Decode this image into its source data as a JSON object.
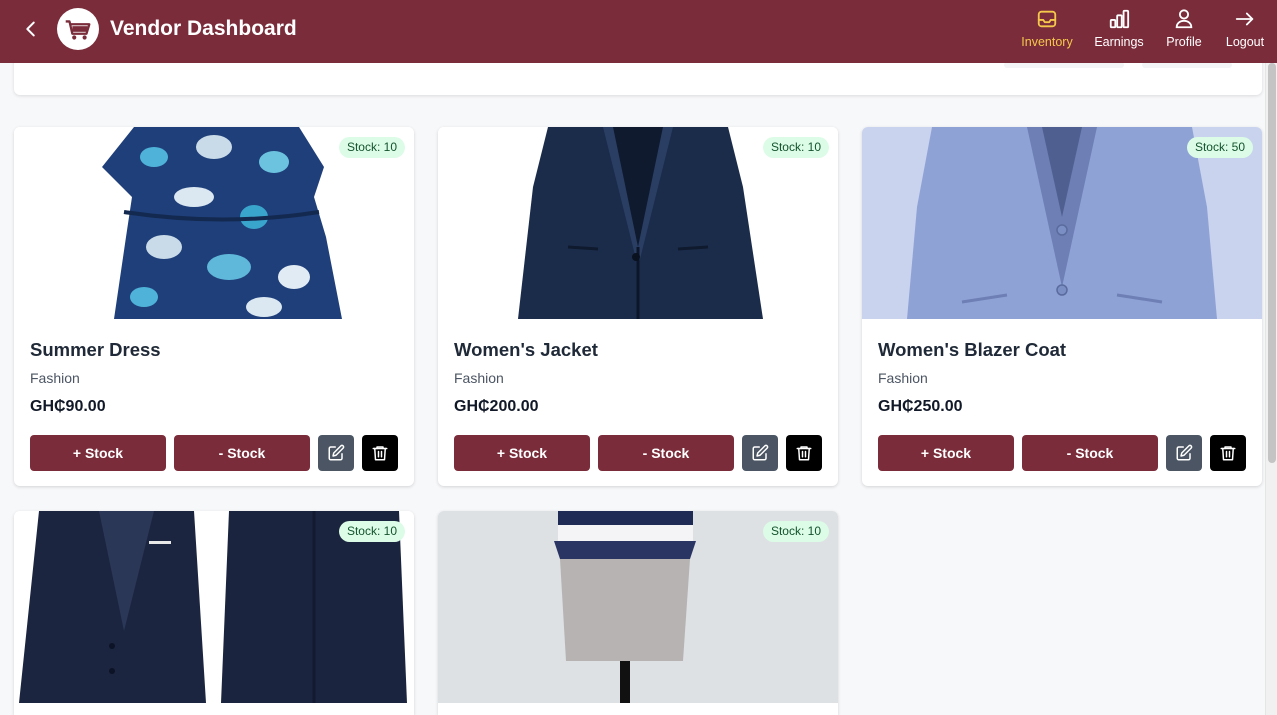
{
  "header": {
    "title": "Vendor Dashboard",
    "nav": [
      {
        "label": "Inventory",
        "icon": "inbox-icon",
        "active": true
      },
      {
        "label": "Earnings",
        "icon": "bar-chart-icon"
      },
      {
        "label": "Profile",
        "icon": "user-icon"
      },
      {
        "label": "Logout",
        "icon": "arrow-right-icon"
      }
    ]
  },
  "colors": {
    "brand": "#7a2c3a",
    "active": "#f5c84c",
    "badge_bg": "#dcfce7",
    "badge_text": "#14532d",
    "edit": "#4b5563",
    "delete": "#000000"
  },
  "actions": {
    "add_stock": "+ Stock",
    "remove_stock": "- Stock",
    "edit_icon": "edit-icon",
    "delete_icon": "trash-icon"
  },
  "products": [
    {
      "name": "Summer Dress",
      "category": "Fashion",
      "price": "GH₵90.00",
      "stock": "Stock: 10"
    },
    {
      "name": "Women's Jacket",
      "category": "Fashion",
      "price": "GH₵200.00",
      "stock": "Stock: 10"
    },
    {
      "name": "Women's Blazer Coat",
      "category": "Fashion",
      "price": "GH₵250.00",
      "stock": "Stock: 50"
    },
    {
      "name": "",
      "category": "",
      "price": "",
      "stock": "Stock: 10"
    },
    {
      "name": "",
      "category": "",
      "price": "",
      "stock": "Stock: 10"
    }
  ]
}
